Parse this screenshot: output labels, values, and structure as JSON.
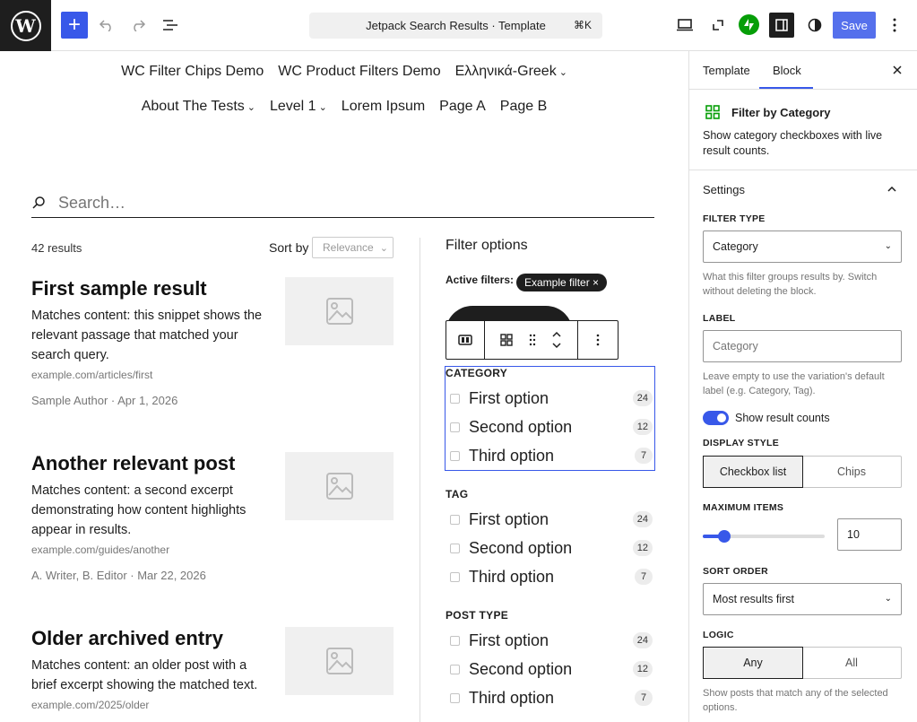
{
  "toolbar": {
    "add_label": "+",
    "document_title": "Jetpack Search Results · Template",
    "shortcut": "⌘K",
    "save_label": "Save"
  },
  "nav": {
    "row1": [
      {
        "label": "WC Filter Chips Demo",
        "dropdown": false
      },
      {
        "label": "WC Product Filters Demo",
        "dropdown": false
      },
      {
        "label": "Ελληνικά-Greek",
        "dropdown": true
      }
    ],
    "row2": [
      {
        "label": "About The Tests",
        "dropdown": true
      },
      {
        "label": "Level 1",
        "dropdown": true
      },
      {
        "label": "Lorem Ipsum",
        "dropdown": false
      },
      {
        "label": "Page A",
        "dropdown": false
      },
      {
        "label": "Page B",
        "dropdown": false
      }
    ]
  },
  "search": {
    "placeholder": "Search…"
  },
  "results": {
    "count": "42 results",
    "sort_label": "Sort by",
    "sort_value": "Relevance",
    "items": [
      {
        "title": "First sample result",
        "snippet": "Matches content: this snippet shows the relevant passage that matched your search query.",
        "url": "example.com/articles/first",
        "meta": "Sample Author · Apr 1, 2026"
      },
      {
        "title": "Another relevant post",
        "snippet": "Matches content: a second excerpt demonstrating how content highlights appear in results.",
        "url": "example.com/guides/another",
        "meta": "A. Writer, B. Editor · Mar 22, 2026"
      },
      {
        "title": "Older archived entry",
        "snippet": "Matches content: an older post with a brief excerpt showing the matched text.",
        "url": "example.com/2025/older",
        "meta": ""
      }
    ]
  },
  "filters": {
    "title": "Filter options",
    "active_label": "Active filters:",
    "active_chip": "Example filter ×",
    "groups": [
      {
        "label": "CATEGORY",
        "options": [
          {
            "label": "First option",
            "count": "24"
          },
          {
            "label": "Second option",
            "count": "12"
          },
          {
            "label": "Third option",
            "count": "7"
          }
        ]
      },
      {
        "label": "TAG",
        "options": [
          {
            "label": "First option",
            "count": "24"
          },
          {
            "label": "Second option",
            "count": "12"
          },
          {
            "label": "Third option",
            "count": "7"
          }
        ]
      },
      {
        "label": "POST TYPE",
        "options": [
          {
            "label": "First option",
            "count": "24"
          },
          {
            "label": "Second option",
            "count": "12"
          },
          {
            "label": "Third option",
            "count": "7"
          }
        ]
      }
    ]
  },
  "sidebar": {
    "tabs": [
      "Template",
      "Block"
    ],
    "active_tab": "Block",
    "block_title": "Filter by Category",
    "block_desc": "Show category checkboxes with live result counts.",
    "settings_title": "Settings",
    "filter_type_label": "FILTER TYPE",
    "filter_type_value": "Category",
    "filter_type_help": "What this filter groups results by. Switch without deleting the block.",
    "label_label": "LABEL",
    "label_placeholder": "Category",
    "label_help": "Leave empty to use the variation's default label (e.g. Category, Tag).",
    "toggle_label": "Show result counts",
    "toggle_on": true,
    "display_style_label": "DISPLAY STYLE",
    "display_options": [
      "Checkbox list",
      "Chips"
    ],
    "max_items_label": "MAXIMUM ITEMS",
    "max_items_value": "10",
    "max_items_fraction": 0.18,
    "sort_order_label": "SORT ORDER",
    "sort_order_value": "Most results first",
    "logic_label": "LOGIC",
    "logic_options": [
      "Any",
      "All"
    ],
    "logic_help": "Show posts that match any of the selected options."
  },
  "colors": {
    "accent": "#3858e9",
    "dark": "#1e1e1e",
    "jetpack": "#069e08"
  }
}
